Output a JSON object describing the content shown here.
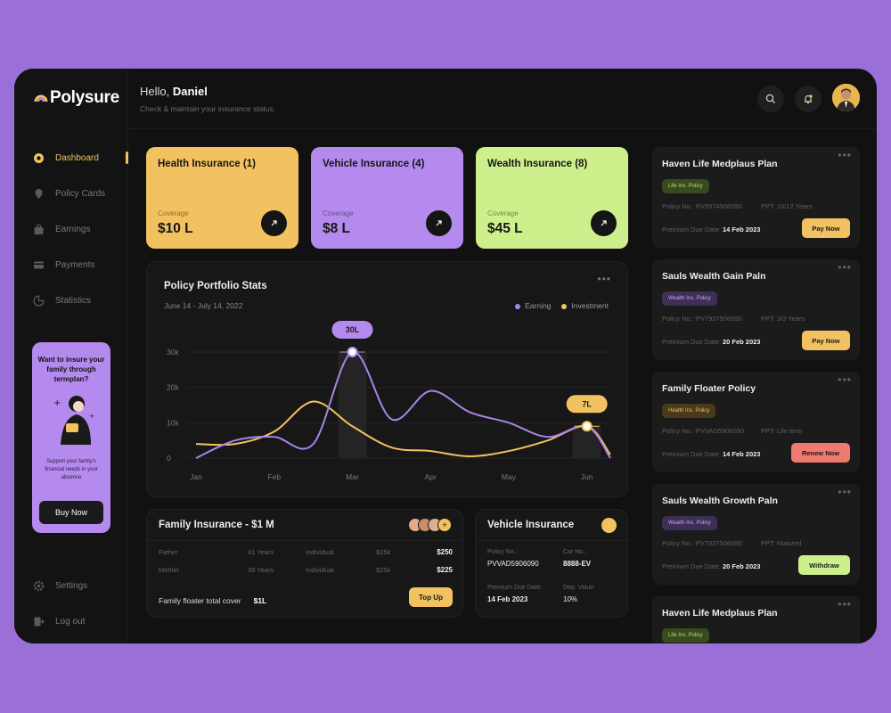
{
  "app": {
    "name": "Polysure"
  },
  "colors": {
    "bg": "#9b6fd8",
    "accent": "#f2c260",
    "purple": "#b58aee",
    "green": "#cdef8c",
    "red": "#f07a70"
  },
  "sidebar": {
    "items": [
      {
        "label": "Dashboard",
        "icon": "dashboard-icon",
        "active": true
      },
      {
        "label": "Policy Cards",
        "icon": "location-pin-icon"
      },
      {
        "label": "Earnings",
        "icon": "bag-icon"
      },
      {
        "label": "Payments",
        "icon": "card-icon"
      },
      {
        "label": "Statistics",
        "icon": "chart-icon"
      }
    ],
    "bottom": [
      {
        "label": "Settings",
        "icon": "gear-icon"
      },
      {
        "label": "Log out",
        "icon": "logout-icon"
      }
    ],
    "promo": {
      "title": "Want to insure your family through termplan?",
      "text": "Support your family's financial needs in your absence",
      "button": "Buy Now"
    }
  },
  "header": {
    "greeting": "Hello,",
    "user": "Daniel",
    "subtitle": "Check & maintain your insurance status."
  },
  "cards": [
    {
      "title": "Health Insurance (1)",
      "label": "Coverage",
      "value": "$10 L",
      "color": "#f2c260"
    },
    {
      "title": "Vehicle Insurance  (4)",
      "label": "Coverage",
      "value": "$8 L",
      "color": "#b58aee"
    },
    {
      "title": "Wealth Insurance (8)",
      "label": "Coverage",
      "value": "$45 L",
      "color": "#cdef8c"
    }
  ],
  "stats": {
    "title": "Policy Portfolio Stats",
    "range": "June 14 - July 14, 2022",
    "legend": [
      "Earning",
      "Investment"
    ]
  },
  "chart_data": {
    "type": "line",
    "title": "Policy Portfolio Stats",
    "categories": [
      "Jan",
      "Feb",
      "Mar",
      "Apr",
      "May",
      "Jun"
    ],
    "yticks": [
      "30k",
      "20k",
      "10k",
      "0"
    ],
    "ylim": [
      0,
      32000
    ],
    "series": [
      {
        "name": "Earning",
        "color": "#a884ea",
        "x": [
          0,
          0.5,
          1,
          1.5,
          2,
          2.5,
          3,
          3.5,
          4,
          4.5,
          5,
          5.3
        ],
        "values": [
          0,
          5000,
          6000,
          4000,
          30000,
          11000,
          19000,
          13000,
          10000,
          6000,
          9000,
          0
        ]
      },
      {
        "name": "Investment",
        "color": "#f2c260",
        "x": [
          0,
          0.5,
          1,
          1.5,
          2,
          2.5,
          3,
          3.5,
          4,
          4.5,
          5,
          5.3
        ],
        "values": [
          4000,
          4000,
          7500,
          16000,
          9000,
          3000,
          2000,
          500,
          2000,
          5000,
          9000,
          1000
        ]
      }
    ],
    "annotations": [
      {
        "label": "30L",
        "x": 2,
        "y": 30000,
        "series": "Earning"
      },
      {
        "label": "7L",
        "x": 5,
        "y": 9000,
        "series": "Investment"
      }
    ]
  },
  "family": {
    "title": "Family Insurance - $1 M",
    "rows": [
      {
        "who": "Father",
        "age": "41 Years",
        "type": "Individual",
        "cover": "$25k",
        "premium": "$250"
      },
      {
        "who": "Mother",
        "age": "39 Years",
        "type": "Individual",
        "cover": "$25k",
        "premium": "$225"
      }
    ],
    "cover_label": "Family floater total cover",
    "cover_value": "$1L",
    "button": "Top Up"
  },
  "vehicle": {
    "title": "Vehicle Insurance",
    "policy_label": "Policy No.:",
    "policy_value": "PVVAD5906090",
    "car_label": "Car No.:",
    "car_value": "8888-EV",
    "due_label": "Premium Due Date:",
    "due_value": "14 Feb 2023",
    "dep_label": "Dep. Value:",
    "dep_value": "10%"
  },
  "policies": [
    {
      "title": "Haven Life Medplaus Plan",
      "badge": "Life Ins. Policy",
      "badge_color": "#3a4a1f",
      "badge_text": "#b9d97a",
      "no": "Policy No.: PV9974906090",
      "ppt": "PPT: 10/12 Years",
      "due_label": "Premium Due Date:",
      "due": "14 Feb 2023",
      "button": "Pay Now",
      "button_color": "#f2c260"
    },
    {
      "title": "Sauls Wealth Gain Paln",
      "badge": "Wealth Ins. Policy",
      "badge_color": "#3d2f55",
      "badge_text": "#c8a8f3",
      "no": "Policy No.: PV7937506090",
      "ppt": "PPT: 3/3 Years",
      "due_label": "Premium Due Date:",
      "due": "20 Feb 2023",
      "button": "Pay Now",
      "button_color": "#f2c260"
    },
    {
      "title": "Family Floater Policy",
      "badge": "Health Ins. Policy",
      "badge_color": "#4a3a1c",
      "badge_text": "#e6c070",
      "no": "Policy No.: PVVAD5906090",
      "ppt": "PPT: Life time",
      "due_label": "Premium Due Date:",
      "due": "14 Feb 2023",
      "button": "Renew Now",
      "button_color": "#f07a70"
    },
    {
      "title": "Sauls Wealth Growth Paln",
      "badge": "Wealth Ins. Policy",
      "badge_color": "#3d2f55",
      "badge_text": "#c8a8f3",
      "no": "Policy No.: PV7937506090",
      "ppt": "PPT: Matured",
      "due_label": "Premium Due Date:",
      "due": "20 Feb 2023",
      "button": "Withdraw",
      "button_color": "#cdef8c"
    },
    {
      "title": "Haven Life Medplaus Plan",
      "badge": "Life Ins. Policy",
      "badge_color": "#3a4a1f",
      "badge_text": "#b9d97a"
    }
  ]
}
